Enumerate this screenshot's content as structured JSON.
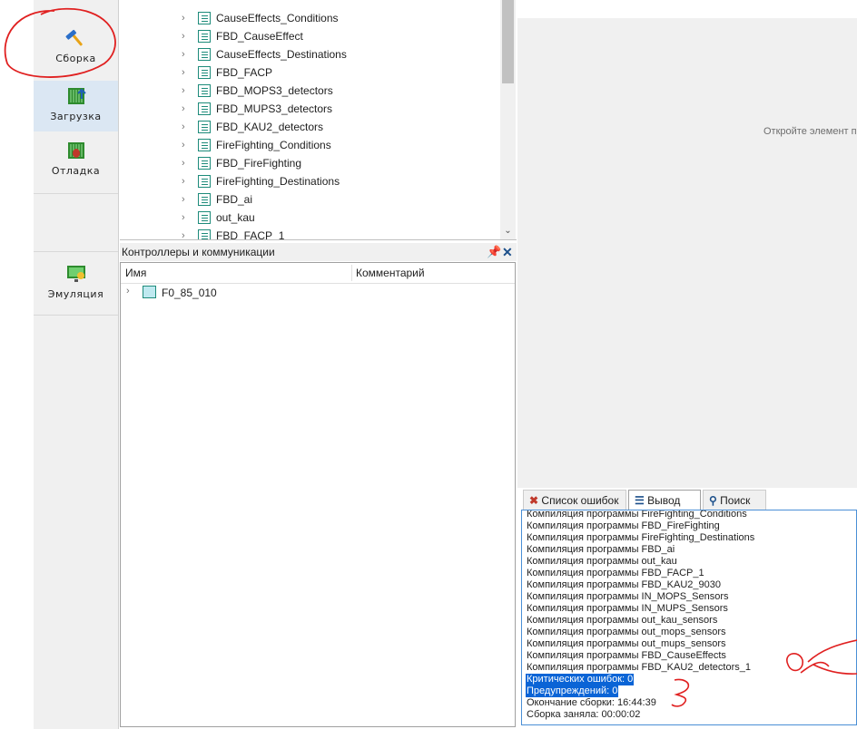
{
  "toolbar": {
    "build_label": "Сборка",
    "upload_label": "Загрузка",
    "debug_label": "Отладка",
    "emulation_label": "Эмуляция"
  },
  "tree": {
    "items": [
      {
        "label": "CauseEffects_Conditions",
        "icon": "list-doc-icon"
      },
      {
        "label": "FBD_CauseEffect",
        "icon": "fbd-icon"
      },
      {
        "label": "CauseEffects_Destinations",
        "icon": "list-doc-icon"
      },
      {
        "label": "FBD_FACP",
        "icon": "fbd-icon"
      },
      {
        "label": "FBD_MOPS3_detectors",
        "icon": "fbd-icon"
      },
      {
        "label": "FBD_MUPS3_detectors",
        "icon": "fbd-icon"
      },
      {
        "label": "FBD_KAU2_detectors",
        "icon": "fbd-icon"
      },
      {
        "label": "FireFighting_Conditions",
        "icon": "list-doc-icon"
      },
      {
        "label": "FBD_FireFighting",
        "icon": "fbd-icon"
      },
      {
        "label": "FireFighting_Destinations",
        "icon": "list-doc-icon"
      },
      {
        "label": "FBD_ai",
        "icon": "fbd-icon"
      },
      {
        "label": "out_kau",
        "icon": "list-doc-icon"
      },
      {
        "label": "FBD_FACP_1",
        "icon": "fbd-icon"
      }
    ]
  },
  "controllers": {
    "title": "Контроллеры и коммуникации",
    "col_name": "Имя",
    "col_comment": "Комментарий",
    "node_label": "F0_85_010"
  },
  "editor": {
    "placeholder": "Откройте элемент п"
  },
  "output_tabs": {
    "errors_label": "Список ошибок",
    "output_label": "Вывод",
    "search_label": "Поиск"
  },
  "output": {
    "lines": [
      "Компиляция программы FireFighting_Conditions",
      "Компиляция программы FBD_FireFighting",
      "Компиляция программы FireFighting_Destinations",
      "Компиляция программы FBD_ai",
      "Компиляция программы out_kau",
      "Компиляция программы FBD_FACP_1",
      "Компиляция программы FBD_KAU2_9030",
      "Компиляция программы IN_MOPS_Sensors",
      "Компиляция программы IN_MUPS_Sensors",
      "Компиляция программы out_kau_sensors",
      "Компиляция программы out_mops_sensors",
      "Компиляция программы out_mups_sensors",
      "Компиляция программы FBD_CauseEffects",
      "Компиляция программы FBD_KAU2_detectors_1",
      "Критических ошибок: 0",
      "Предупреждений: 0",
      "Окончание сборки: 16:44:39",
      "Сборка заняла: 00:00:02"
    ],
    "selected_lines": [
      14,
      15
    ]
  },
  "colors": {
    "accent_teal": "#1d8b7a",
    "selection_blue": "#0a64d6",
    "annotation_red": "#e02020"
  }
}
